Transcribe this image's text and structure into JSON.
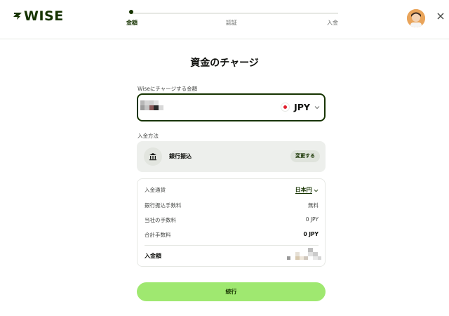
{
  "brand": {
    "name": "WISE",
    "color": "#163300",
    "accent": "#9fe870"
  },
  "stepper": {
    "steps": [
      {
        "label": "金額",
        "active": true
      },
      {
        "label": "認証",
        "active": false
      },
      {
        "label": "入金",
        "active": false
      }
    ]
  },
  "header": {
    "avatar_icon": "avatar",
    "close_icon": "close-icon"
  },
  "page": {
    "title": "資金のチャージ"
  },
  "amount": {
    "label": "Wiseにチャージする金額",
    "value_hidden": true,
    "currency": "JPY",
    "flag_icon": "japan-flag-icon"
  },
  "method": {
    "label": "入金方法",
    "name": "銀行振込",
    "change_label": "変更する",
    "icon": "bank-icon"
  },
  "summary": {
    "rows": [
      {
        "label": "入金通貨",
        "value": "日本円"
      },
      {
        "label": "銀行振込手数料",
        "value": "無料"
      },
      {
        "label": "当社の手数料",
        "value": "0 JPY"
      },
      {
        "label": "合計手数料",
        "value": "0 JPY"
      }
    ],
    "total_label": "入金額",
    "total_hidden": true
  },
  "actions": {
    "continue_label": "続行"
  }
}
